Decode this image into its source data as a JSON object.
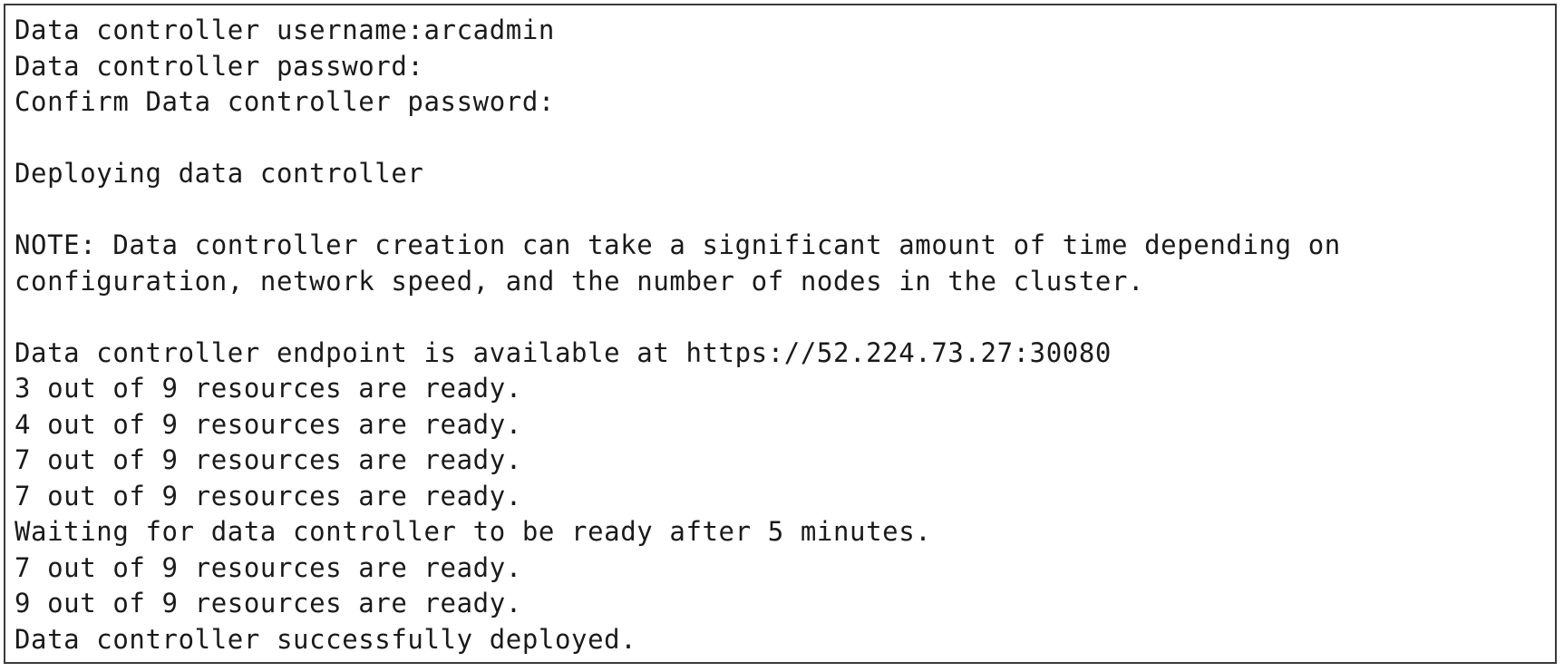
{
  "console": {
    "lines": [
      "Data controller username:arcadmin",
      "Data controller password:",
      "Confirm Data controller password:",
      "",
      "Deploying data controller",
      "",
      "NOTE: Data controller creation can take a significant amount of time depending on",
      "configuration, network speed, and the number of nodes in the cluster.",
      "",
      "Data controller endpoint is available at https://52.224.73.27:30080",
      "3 out of 9 resources are ready.",
      "4 out of 9 resources are ready.",
      "7 out of 9 resources are ready.",
      "7 out of 9 resources are ready.",
      "Waiting for data controller to be ready after 5 minutes.",
      "7 out of 9 resources are ready.",
      "9 out of 9 resources are ready.",
      "Data controller successfully deployed."
    ]
  }
}
